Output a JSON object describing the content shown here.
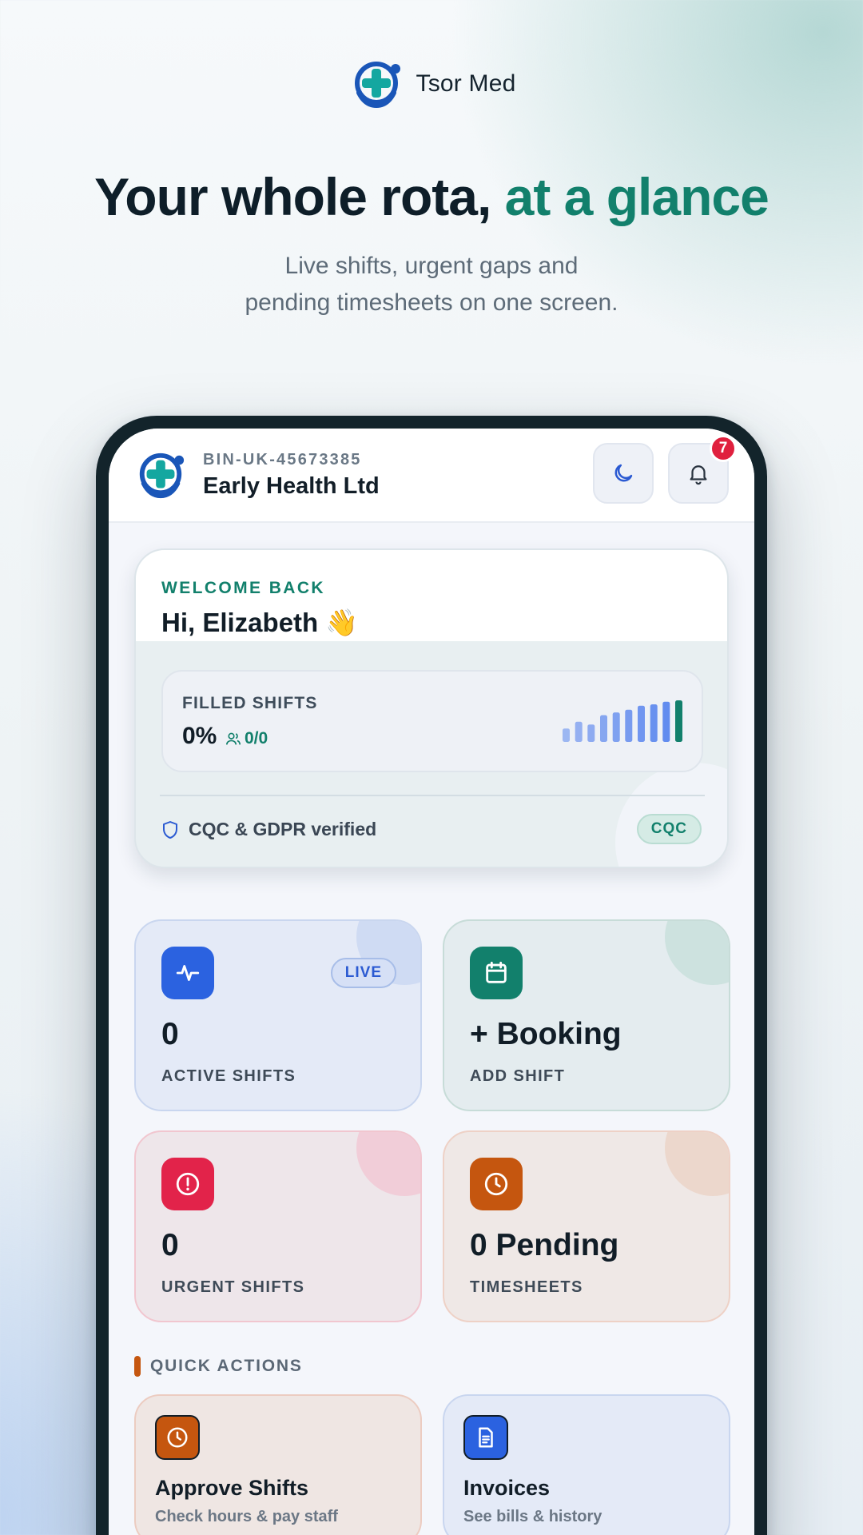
{
  "brand": {
    "name": "Tsor Med"
  },
  "hero": {
    "headline_main": "Your whole rota, ",
    "headline_accent": "at a glance",
    "sub_line1": "Live shifts, urgent gaps and",
    "sub_line2": "pending timesheets on one screen."
  },
  "app": {
    "org_id": "BIN-UK-45673385",
    "org_name": "Early Health Ltd",
    "theme_icon": "moon-icon",
    "notifications": {
      "icon": "bell-icon",
      "count": "7"
    }
  },
  "welcome": {
    "label": "WELCOME BACK",
    "greeting": "Hi, Elizabeth 👋",
    "filled_label": "FILLED SHIFTS",
    "filled_percent": "0%",
    "filled_count": "0/0",
    "trend_bars": [
      2,
      3,
      2.6,
      4,
      4.4,
      4.8,
      5.4,
      5.6,
      6,
      6.2
    ],
    "verified_text": "CQC & GDPR verified",
    "cqc_chip": "CQC"
  },
  "stats": {
    "active": {
      "value": "0",
      "label": "ACTIVE SHIFTS",
      "chip": "LIVE",
      "icon": "activity-icon"
    },
    "booking": {
      "value": "+ Booking",
      "label": "ADD SHIFT",
      "icon": "calendar-icon"
    },
    "urgent": {
      "value": "0",
      "label": "URGENT SHIFTS",
      "icon": "alert-icon"
    },
    "pending": {
      "value": "0 Pending",
      "label": "TIMESHEETS",
      "icon": "clock-icon"
    }
  },
  "quick_actions": {
    "title": "QUICK ACTIONS",
    "items": [
      {
        "title": "Approve Shifts",
        "subtitle": "Check hours & pay staff",
        "icon": "clock-icon"
      },
      {
        "title": "Invoices",
        "subtitle": "See bills & history",
        "icon": "document-icon"
      }
    ]
  },
  "colors": {
    "accent_teal": "#12806c",
    "accent_blue": "#2b62e0",
    "urgent_red": "#e2234a",
    "pending_orange": "#c5560f",
    "bar_blue": "#5a86ee",
    "bar_last": "#12806c"
  }
}
